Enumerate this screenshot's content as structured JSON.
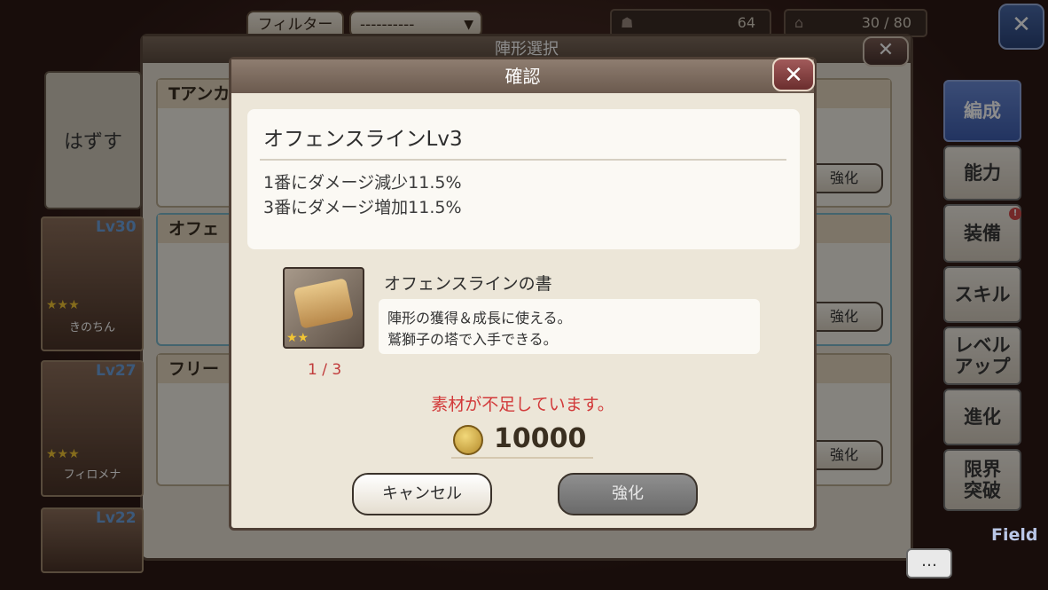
{
  "topbar": {
    "filter_label": "フィルター",
    "filter_select_value": "----------",
    "unit_count": "64",
    "capacity": "30 / 80"
  },
  "right_tabs": [
    "編成",
    "能力",
    "装備",
    "スキル",
    "レベルアップ",
    "進化",
    "限界突破"
  ],
  "background_panel": {
    "title": "陣形選択",
    "unequip_label": "はずす",
    "formation_cards": [
      {
        "name": "Tアンカ",
        "button": "強化"
      },
      {
        "name": "オフェ",
        "button": "強化"
      },
      {
        "name": "フリー",
        "button": "強化"
      }
    ],
    "characters": [
      {
        "level": "Lv30",
        "name": "きのちん",
        "stars": "★★★"
      },
      {
        "level": "Lv27",
        "name": "フィロメナ",
        "stars": "★★★"
      },
      {
        "level": "Lv22",
        "name": "",
        "stars": ""
      }
    ]
  },
  "modal": {
    "title": "確認",
    "skill_name": "オフェンスラインLv3",
    "effects": [
      "1番にダメージ減少11.5%",
      "3番にダメージ増加11.5%"
    ],
    "item_name": "オフェンスラインの書",
    "item_description": [
      "陣形の獲得＆成長に使える。",
      "鷲獅子の塔で入手できる。"
    ],
    "item_stars": "★★",
    "item_count": "1 / 3",
    "warning": "素材が不足しています。",
    "cost": "10000",
    "cancel_label": "キャンセル",
    "confirm_label": "強化"
  },
  "misc": {
    "chat_icon": "…",
    "field_label": "Field"
  },
  "colors": {
    "warning": "#d23a3a",
    "active_tab": "#4f6fc0",
    "level_text": "#6ea2de"
  }
}
